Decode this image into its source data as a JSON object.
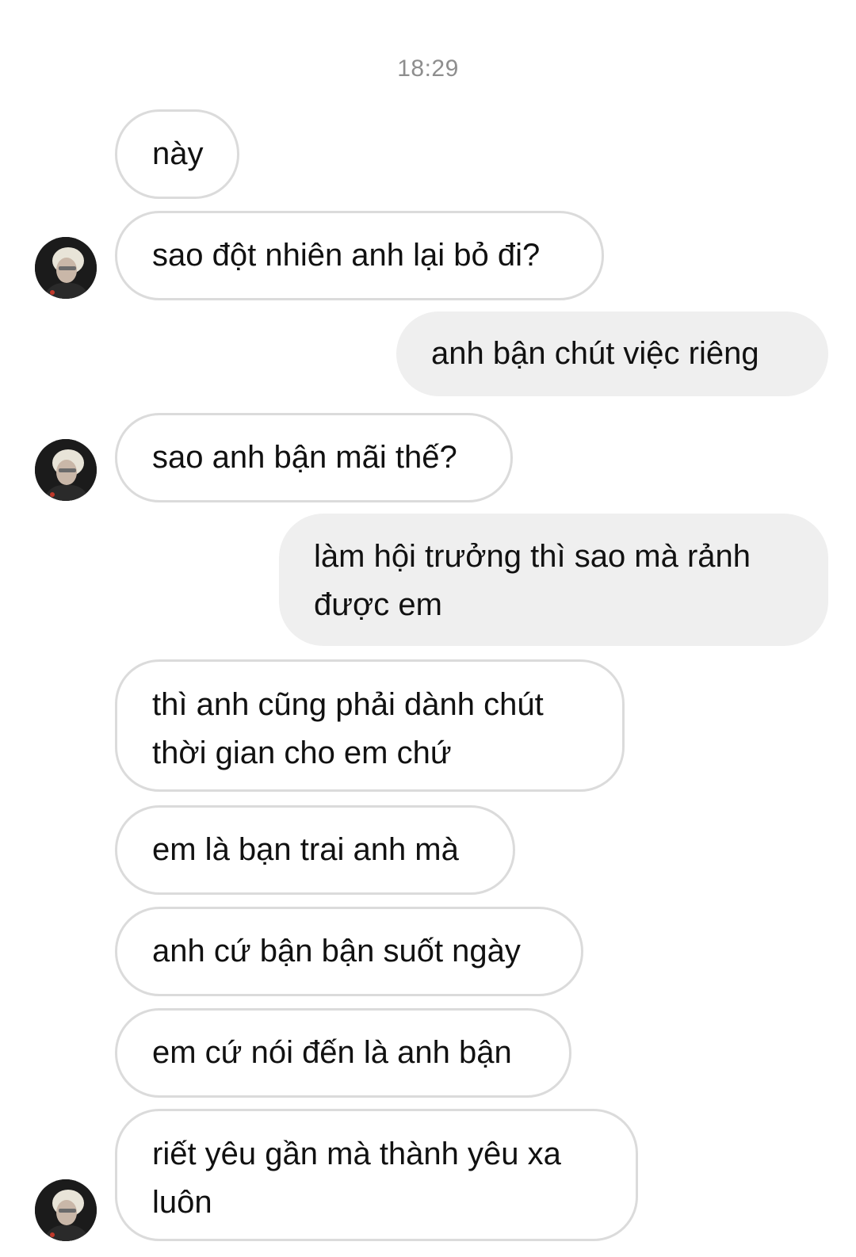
{
  "chat": {
    "timestamp": "18:29",
    "messages": [
      {
        "direction": "incoming",
        "text": "này"
      },
      {
        "direction": "incoming",
        "text": "sao đột nhiên anh lại bỏ đi?"
      },
      {
        "direction": "outgoing",
        "text": "anh bận chút việc riêng"
      },
      {
        "direction": "incoming",
        "text": "sao anh bận mãi thế?"
      },
      {
        "direction": "outgoing",
        "text": "làm hội trưởng thì sao mà rảnh được em"
      },
      {
        "direction": "incoming",
        "text": "thì anh cũng phải dành chút thời gian cho em chứ"
      },
      {
        "direction": "incoming",
        "text": "em là bạn trai anh mà"
      },
      {
        "direction": "incoming",
        "text": "anh cứ bận bận suốt ngày"
      },
      {
        "direction": "incoming",
        "text": "em cứ nói đến là anh bận"
      },
      {
        "direction": "incoming",
        "text": "riết yêu gần mà thành yêu xa luôn"
      }
    ]
  },
  "colors": {
    "incoming_bubble_bg": "#ffffff",
    "incoming_bubble_border": "#dbdbdb",
    "outgoing_bubble_bg": "#efefef",
    "timestamp_text": "#8e8e8e"
  },
  "avatar": {
    "icon": "contact-avatar-icon"
  }
}
